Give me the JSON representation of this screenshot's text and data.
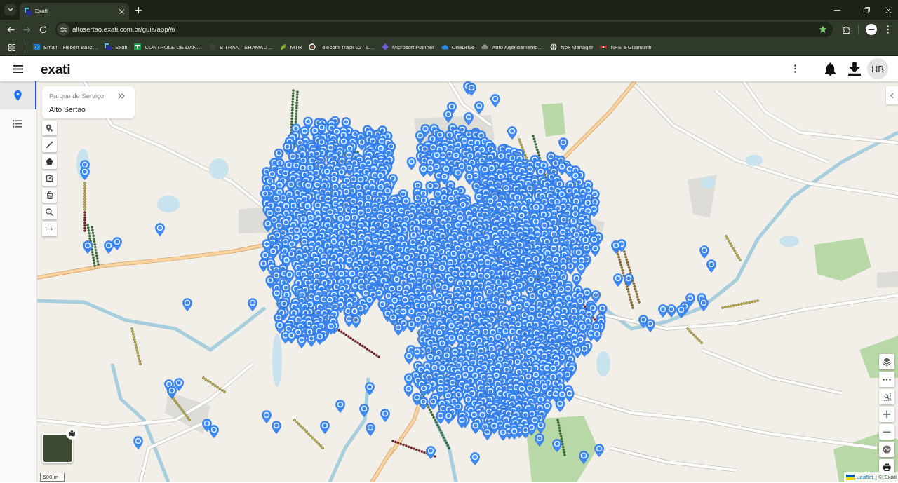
{
  "browser": {
    "tabs": [
      {
        "title": "Exati",
        "selected": true
      }
    ],
    "back_disabled": false,
    "forward_disabled": true,
    "address": "altosertao.exati.com.br/guia/app/#/",
    "bookmarked": true,
    "bookmarks": [
      "Email – Hebert Baliz…",
      "Exati",
      "CONTROLE DE DAN…",
      "SITRAN - SHAMAD…",
      "MTR",
      "Telecom Track v2 - L…",
      "Microsoft Planner",
      "OneDrive",
      "Auto Agendamento…",
      "Nox Manager",
      "NFS-e Guanambi"
    ]
  },
  "app": {
    "logo": "exati",
    "user_initials": "HB"
  },
  "sidebar": {
    "items": [
      {
        "kind": "map",
        "selected": true
      },
      {
        "kind": "list",
        "selected": false
      }
    ]
  },
  "panel": {
    "label": "Parque de Serviço",
    "value": "Alto Sertão"
  },
  "map": {
    "scale": "500 m",
    "attribution_link": "Leaflet",
    "attribution_text": "| © Exati"
  }
}
